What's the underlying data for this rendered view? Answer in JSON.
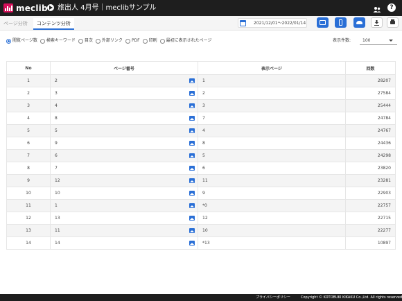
{
  "header": {
    "logo_text": "meclib",
    "book_title": "旅出人 4月号｜meclibサンプル",
    "icons": {
      "book": "book-play-icon",
      "users": "users-icon",
      "help": "help-icon"
    }
  },
  "tabs": [
    {
      "label": "ページ分析",
      "active": false
    },
    {
      "label": "コンテンツ分析",
      "active": true
    }
  ],
  "toolbar": {
    "date_range": "2021/12/01～2022/01/14",
    "device_buttons": [
      "tablet-icon",
      "smartphone-icon",
      "cloud-icon"
    ],
    "action_buttons": [
      "download-icon",
      "print-icon"
    ]
  },
  "filters": {
    "options": [
      "閲覧ページ数",
      "検索キーワード",
      "目次",
      "外部リンク",
      "PDF",
      "印刷",
      "最初に表示されたページ"
    ],
    "selected_index": 0
  },
  "display_count": {
    "label": "表示件数:",
    "value": "100"
  },
  "table": {
    "headers": {
      "no": "No",
      "page": "ページ番号",
      "display": "表示ページ",
      "count": "回数"
    },
    "rows": [
      {
        "no": "1",
        "page": "2",
        "display": "1",
        "count": "28207"
      },
      {
        "no": "2",
        "page": "3",
        "display": "2",
        "count": "27584"
      },
      {
        "no": "3",
        "page": "4",
        "display": "3",
        "count": "25444"
      },
      {
        "no": "4",
        "page": "8",
        "display": "7",
        "count": "24784"
      },
      {
        "no": "5",
        "page": "5",
        "display": "4",
        "count": "24767"
      },
      {
        "no": "6",
        "page": "9",
        "display": "8",
        "count": "24436"
      },
      {
        "no": "7",
        "page": "6",
        "display": "5",
        "count": "24298"
      },
      {
        "no": "8",
        "page": "7",
        "display": "6",
        "count": "23820"
      },
      {
        "no": "9",
        "page": "12",
        "display": "11",
        "count": "23281"
      },
      {
        "no": "10",
        "page": "10",
        "display": "9",
        "count": "22903"
      },
      {
        "no": "11",
        "page": "1",
        "display": "*0",
        "count": "22757"
      },
      {
        "no": "12",
        "page": "13",
        "display": "12",
        "count": "22715"
      },
      {
        "no": "13",
        "page": "11",
        "display": "10",
        "count": "22277"
      },
      {
        "no": "14",
        "page": "14",
        "display": "*13",
        "count": "10897"
      }
    ]
  },
  "footer": {
    "privacy": "プライバシーポリシー",
    "copyright": "Copyright © KOTOBUKI KIKAKU Co.,Ltd. All rights reserved."
  },
  "colors": {
    "accent": "#2a6fd6",
    "header_bg": "#1e1e1e",
    "brand": "#d6105a"
  }
}
